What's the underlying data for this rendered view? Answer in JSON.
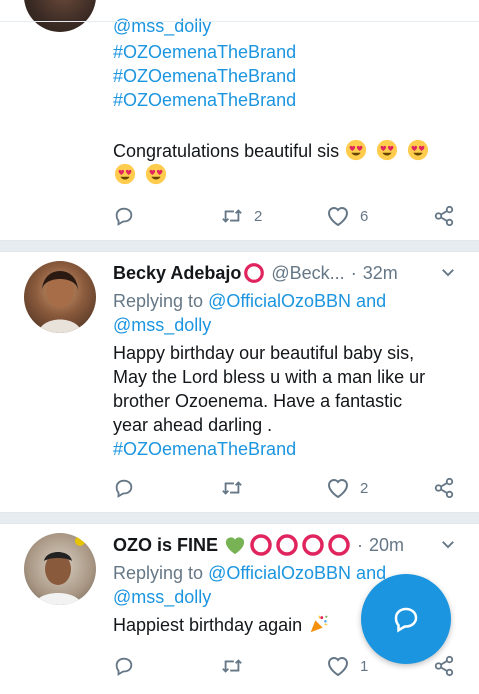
{
  "tweet0": {
    "lines": [
      "@mss_dolly",
      "#OZOemenaTheBrand",
      "#OZOemenaTheBrand",
      "#OZOemenaTheBrand"
    ],
    "text": "Congratulations beautiful sis",
    "retweets": "2",
    "likes": "6"
  },
  "tweet1": {
    "name": "Becky Adebajo",
    "handle": "@Beck...",
    "dot": "·",
    "time": "32m",
    "replying_prefix": "Replying to",
    "replying_to_1": "@OfficialOzoBBN and",
    "replying_to_2": "@mss_dolly",
    "text_lines": [
      "Happy birthday our beautiful baby sis,",
      "May the Lord bless u with a man like ur",
      "brother Ozoenema. Have a fantastic",
      "year ahead darling ."
    ],
    "hashtag": "#OZOemenaTheBrand",
    "likes": "2"
  },
  "tweet2": {
    "name": "OZO is FINE",
    "dot": "·",
    "time": "20m",
    "replying_prefix": "Replying to",
    "replying_to_1": "@OfficialOzoBBN and",
    "replying_to_2": "@mss_dolly",
    "text": "Happiest birthday again",
    "likes": "1"
  },
  "colors": {
    "accent": "#1b95e0",
    "muted": "#657786",
    "red_circle": "#e0245e",
    "heart_green": "#77b255"
  },
  "icons": [
    "reply-icon",
    "retweet-icon",
    "like-icon",
    "share-icon",
    "chevron-down-icon",
    "compose-icon"
  ]
}
